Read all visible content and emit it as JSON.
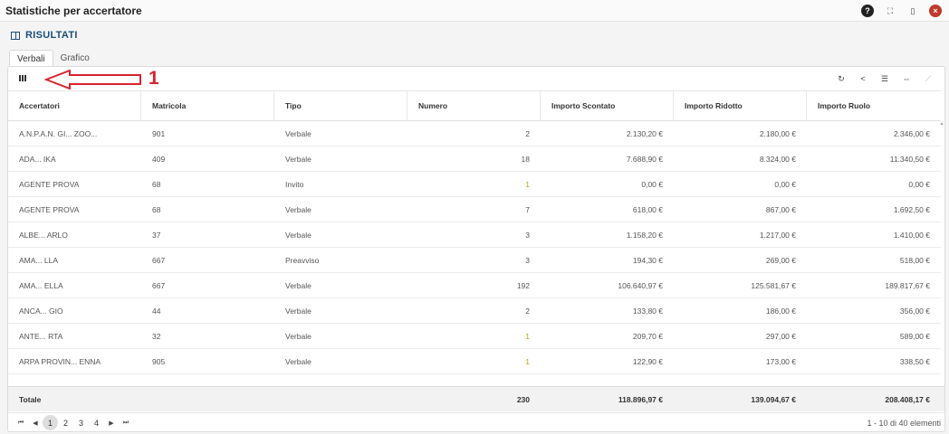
{
  "window": {
    "title": "Statistiche per accertatore",
    "icons": [
      "help-icon",
      "expand-icon",
      "bookmark-icon",
      "close-icon"
    ]
  },
  "section": {
    "title": "RISULTATI"
  },
  "tabs": [
    {
      "label": "Verbali",
      "active": true
    },
    {
      "label": "Grafico",
      "active": false
    }
  ],
  "annotation": {
    "number": "1",
    "color": "#d9232e"
  },
  "toolbar": {
    "icons": [
      "refresh-icon",
      "share-icon",
      "list-icon",
      "columns-fit-icon",
      "trend-icon"
    ]
  },
  "table": {
    "columns": [
      "Accertatori",
      "Matricola",
      "Tipo",
      "Numero",
      "Importo Scontato",
      "Importo Ridotto",
      "Importo Ruolo"
    ],
    "rows": [
      [
        "A.N.P.A.N. GI... ZOO...",
        "901",
        "Verbale",
        "2",
        "2.130,20 €",
        "2.180,00 €",
        "2.346,00 €"
      ],
      [
        "ADA... IKA",
        "409",
        "Verbale",
        "18",
        "7.688,90 €",
        "8.324,00 €",
        "11.340,50 €"
      ],
      [
        "AGENTE PROVA",
        "68",
        "Invito",
        "1",
        "0,00 €",
        "0,00 €",
        "0,00 €"
      ],
      [
        "AGENTE PROVA",
        "68",
        "Verbale",
        "7",
        "618,00 €",
        "867,00 €",
        "1.692,50 €"
      ],
      [
        "ALBE... ARLO",
        "37",
        "Verbale",
        "3",
        "1.158,20 €",
        "1.217,00 €",
        "1.410,00 €"
      ],
      [
        "AMA... LLA",
        "667",
        "Preavviso",
        "3",
        "194,30 €",
        "269,00 €",
        "518,00 €"
      ],
      [
        "AMA... ELLA",
        "667",
        "Verbale",
        "192",
        "106.640,97 €",
        "125.581,67 €",
        "189.817,67 €"
      ],
      [
        "ANCA... GIO",
        "44",
        "Verbale",
        "2",
        "133,80 €",
        "186,00 €",
        "356,00 €"
      ],
      [
        "ANTE... RTA",
        "32",
        "Verbale",
        "1",
        "209,70 €",
        "297,00 €",
        "589,00 €"
      ],
      [
        "ARPA PROVIN... ENNA",
        "905",
        "Verbale",
        "1",
        "122,90 €",
        "173,00 €",
        "338,50 €"
      ]
    ],
    "highlight_color": "#c8a000"
  },
  "totals": {
    "label": "Totale",
    "numero": "230",
    "importo_scontato": "118.896,97 €",
    "importo_ridotto": "139.094,67 €",
    "importo_ruolo": "208.408,17 €"
  },
  "pager": {
    "first": "⏮",
    "prev": "◀",
    "next": "▶",
    "last": "⏭",
    "pages": [
      "1",
      "2",
      "3",
      "4"
    ],
    "current_page": "1",
    "info": "1 - 10 di 40 elementi"
  }
}
